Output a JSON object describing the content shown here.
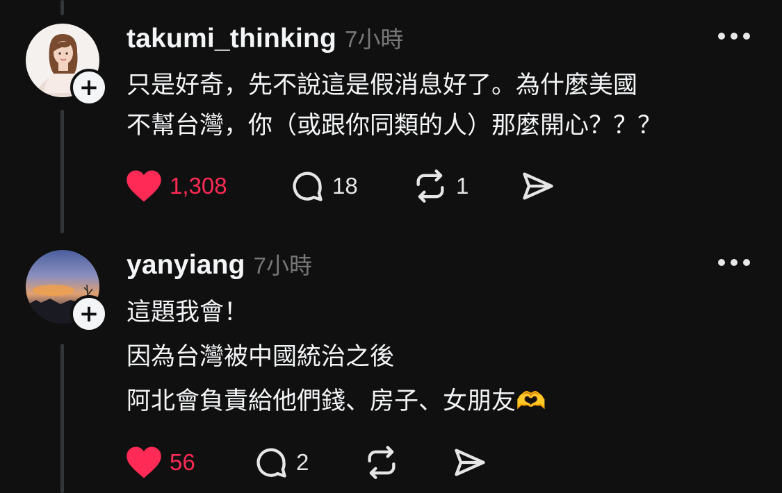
{
  "posts": [
    {
      "username": "takumi_thinking",
      "timestamp": "7小時",
      "avatar_icon": "woman-portrait-avatar",
      "body": "只是好奇，先不說這是假消息好了。為什麼美國\n不幫台灣，你（或跟你同類的人）那麼開心？？？",
      "likes": "1,308",
      "liked": true,
      "replies": "18",
      "reposts": "1"
    },
    {
      "username": "yanyiang",
      "timestamp": "7小時",
      "avatar_icon": "sunset-sky-avatar",
      "body": "這題我會！\n因為台灣被中國統治之後\n阿北會負責給他們錢、房子、女朋友🫶",
      "likes": "56",
      "liked": true,
      "replies": "2",
      "reposts": ""
    }
  ],
  "colors": {
    "background": "#101010",
    "text": "#f3f5f7",
    "muted": "#777777",
    "like_red": "#ff2a55"
  },
  "icons": [
    "heart-icon",
    "comment-bubble-icon",
    "repost-icon",
    "share-send-icon",
    "more-dots-icon",
    "follow-plus-icon"
  ]
}
